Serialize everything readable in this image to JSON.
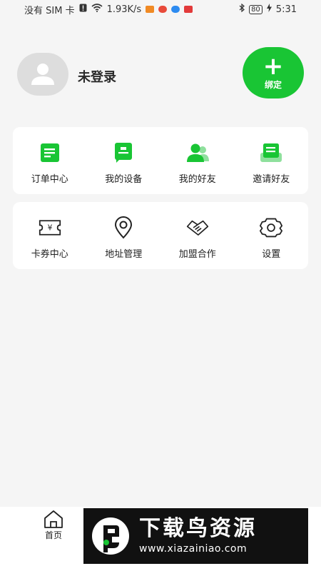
{
  "status_bar": {
    "carrier": "没有 SIM 卡",
    "speed": "1.93K/s",
    "battery": "80",
    "time": "5:31"
  },
  "profile": {
    "login_status": "未登录",
    "bind_label": "绑定"
  },
  "card1": {
    "items": [
      {
        "label": "订单中心",
        "icon": "order-icon"
      },
      {
        "label": "我的设备",
        "icon": "device-icon"
      },
      {
        "label": "我的好友",
        "icon": "friends-icon"
      },
      {
        "label": "邀请好友",
        "icon": "invite-icon"
      }
    ]
  },
  "card2": {
    "items": [
      {
        "label": "卡券中心",
        "icon": "coupon-icon"
      },
      {
        "label": "地址管理",
        "icon": "location-icon"
      },
      {
        "label": "加盟合作",
        "icon": "handshake-icon"
      },
      {
        "label": "设置",
        "icon": "gear-icon"
      }
    ]
  },
  "tab_bar": {
    "home_label": "首页"
  },
  "watermark": {
    "title": "下载鸟资源",
    "url": "www.xiazainiao.com"
  },
  "colors": {
    "accent": "#19c534",
    "background": "#f5f5f5"
  }
}
